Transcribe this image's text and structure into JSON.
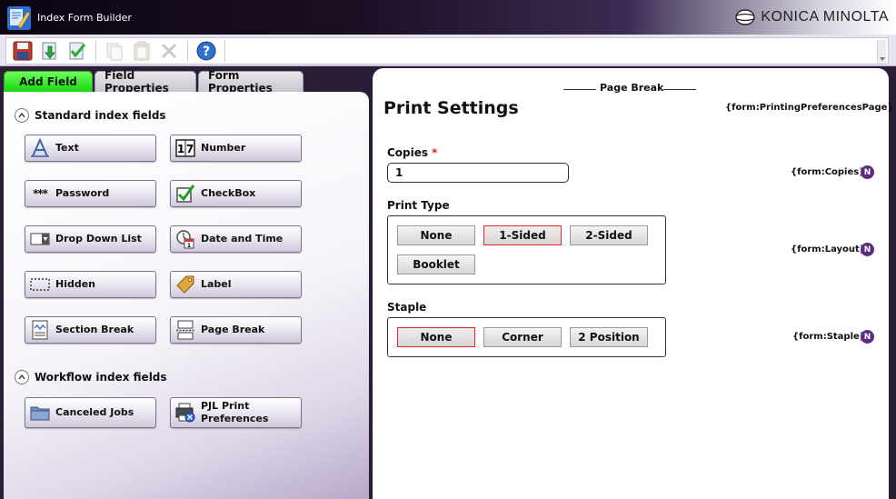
{
  "window": {
    "title": "Index Form Builder",
    "brand": "KONICA MINOLTA"
  },
  "toolbar": {
    "buttons": [
      {
        "icon": "save-icon",
        "enabled": true
      },
      {
        "icon": "import-icon",
        "enabled": true
      },
      {
        "icon": "validate-icon",
        "enabled": true
      },
      {
        "icon": "copy-icon",
        "enabled": false
      },
      {
        "icon": "paste-icon",
        "enabled": false
      },
      {
        "icon": "delete-icon",
        "enabled": false
      },
      {
        "icon": "help-icon",
        "enabled": true
      }
    ]
  },
  "tabs": [
    {
      "label": "Add Field",
      "active": true
    },
    {
      "label": "Field Properties",
      "active": false
    },
    {
      "label": "Form Properties",
      "active": false
    }
  ],
  "standard": {
    "heading": "Standard index fields",
    "buttons": [
      {
        "label": "Text",
        "icon": "text-field-icon"
      },
      {
        "label": "Number",
        "icon": "number-field-icon"
      },
      {
        "label": "Password",
        "icon": "password-icon"
      },
      {
        "label": "CheckBox",
        "icon": "checkbox-icon"
      },
      {
        "label": "Drop Down List",
        "icon": "dropdown-list-icon"
      },
      {
        "label": "Date and Time",
        "icon": "calendar-clock-icon"
      },
      {
        "label": "Hidden",
        "icon": "hidden-field-icon"
      },
      {
        "label": "Label",
        "icon": "label-tag-icon"
      },
      {
        "label": "Section Break",
        "icon": "section-break-icon"
      },
      {
        "label": "Page Break",
        "icon": "page-break-icon"
      }
    ]
  },
  "workflow": {
    "heading": "Workflow index fields",
    "buttons": [
      {
        "label": "Canceled Jobs",
        "icon": "folder-icon"
      },
      {
        "label": "PJL Print Preferences",
        "label_line1": "PJL Print",
        "label_line2": "Preferences",
        "icon": "printer-settings-icon"
      }
    ]
  },
  "form": {
    "page_break_label": "Page Break",
    "title": "Print Settings",
    "title_tag": "{form:PrintingPreferencesPage}",
    "copies": {
      "label": "Copies",
      "required_mark": "*",
      "value": "1",
      "tag": "{form:Copies}",
      "badge": "N"
    },
    "print_type": {
      "label": "Print Type",
      "options": [
        "None",
        "1-Sided",
        "2-Sided",
        "Booklet"
      ],
      "selected": "1-Sided",
      "tag": "{form:Layout}",
      "badge": "N"
    },
    "staple": {
      "label": "Staple",
      "options": [
        "None",
        "Corner",
        "2 Position"
      ],
      "selected": "None",
      "tag": "{form:Staple}",
      "badge": "N"
    }
  },
  "colors": {
    "active_tab": "#18d60e",
    "required": "#d81e1e",
    "selected_option_border": "#e02a2a",
    "badge": "#5a2d82"
  }
}
